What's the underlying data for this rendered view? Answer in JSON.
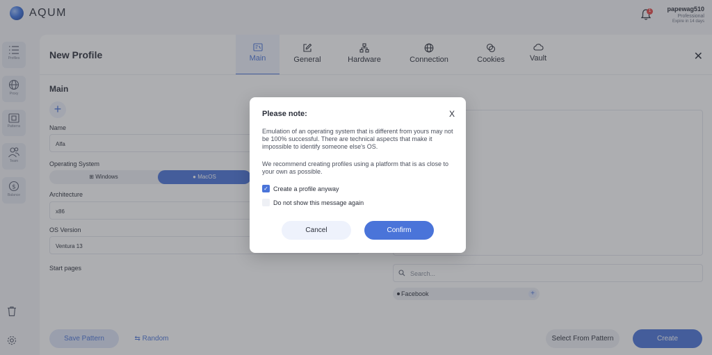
{
  "app": {
    "brand": "AQUM"
  },
  "user": {
    "name": "papewag510",
    "plan": "Professional",
    "expires": "Expire in 14 days",
    "notifications": "1"
  },
  "sidebar": {
    "items": [
      {
        "label": "Profiles",
        "icon": "list-icon"
      },
      {
        "label": "Proxy",
        "icon": "globe-icon"
      },
      {
        "label": "Patterns",
        "icon": "pattern-icon"
      },
      {
        "label": "Team",
        "icon": "team-icon"
      },
      {
        "label": "Balance",
        "icon": "dollar-icon"
      }
    ]
  },
  "panel": {
    "title": "New Profile",
    "tabs": [
      {
        "label": "Main",
        "icon": "id-card-icon"
      },
      {
        "label": "General",
        "icon": "edit-icon"
      },
      {
        "label": "Hardware",
        "icon": "hardware-icon"
      },
      {
        "label": "Connection",
        "icon": "globe-icon"
      },
      {
        "label": "Cookies",
        "icon": "cookie-icon"
      },
      {
        "label": "Vault",
        "icon": "cloud-icon"
      }
    ],
    "section_title": "Main",
    "name_label": "Name",
    "name_value": "Alfa",
    "os_label": "Operating System",
    "os_options": [
      "Windows",
      "MacOS"
    ],
    "arch_label": "Architecture",
    "arch_value": "x86",
    "version_label": "OS Version",
    "version_value": "Ventura 13",
    "start_pages_label": "Start pages",
    "search_placeholder": "Search...",
    "chip": "Facebook",
    "buttons": {
      "save_pattern": "Save Pattern",
      "random": "⇆ Random",
      "select_pattern": "Select From Pattern",
      "create": "Create"
    }
  },
  "modal": {
    "title": "Please note:",
    "close": "X",
    "paragraph1": "Emulation of an operating system that is different from yours may not be 100% successful. There are technical aspects that make it impossible to identify someone else's OS.",
    "paragraph2": "We recommend creating profiles using a platform that is as close to your own as possible.",
    "check1": "Create a profile anyway",
    "check2": "Do not show this message again",
    "cancel": "Cancel",
    "confirm": "Confirm"
  },
  "colors": {
    "accent": "#4a74d9",
    "overlay": "rgba(60,62,70,0.42)"
  }
}
